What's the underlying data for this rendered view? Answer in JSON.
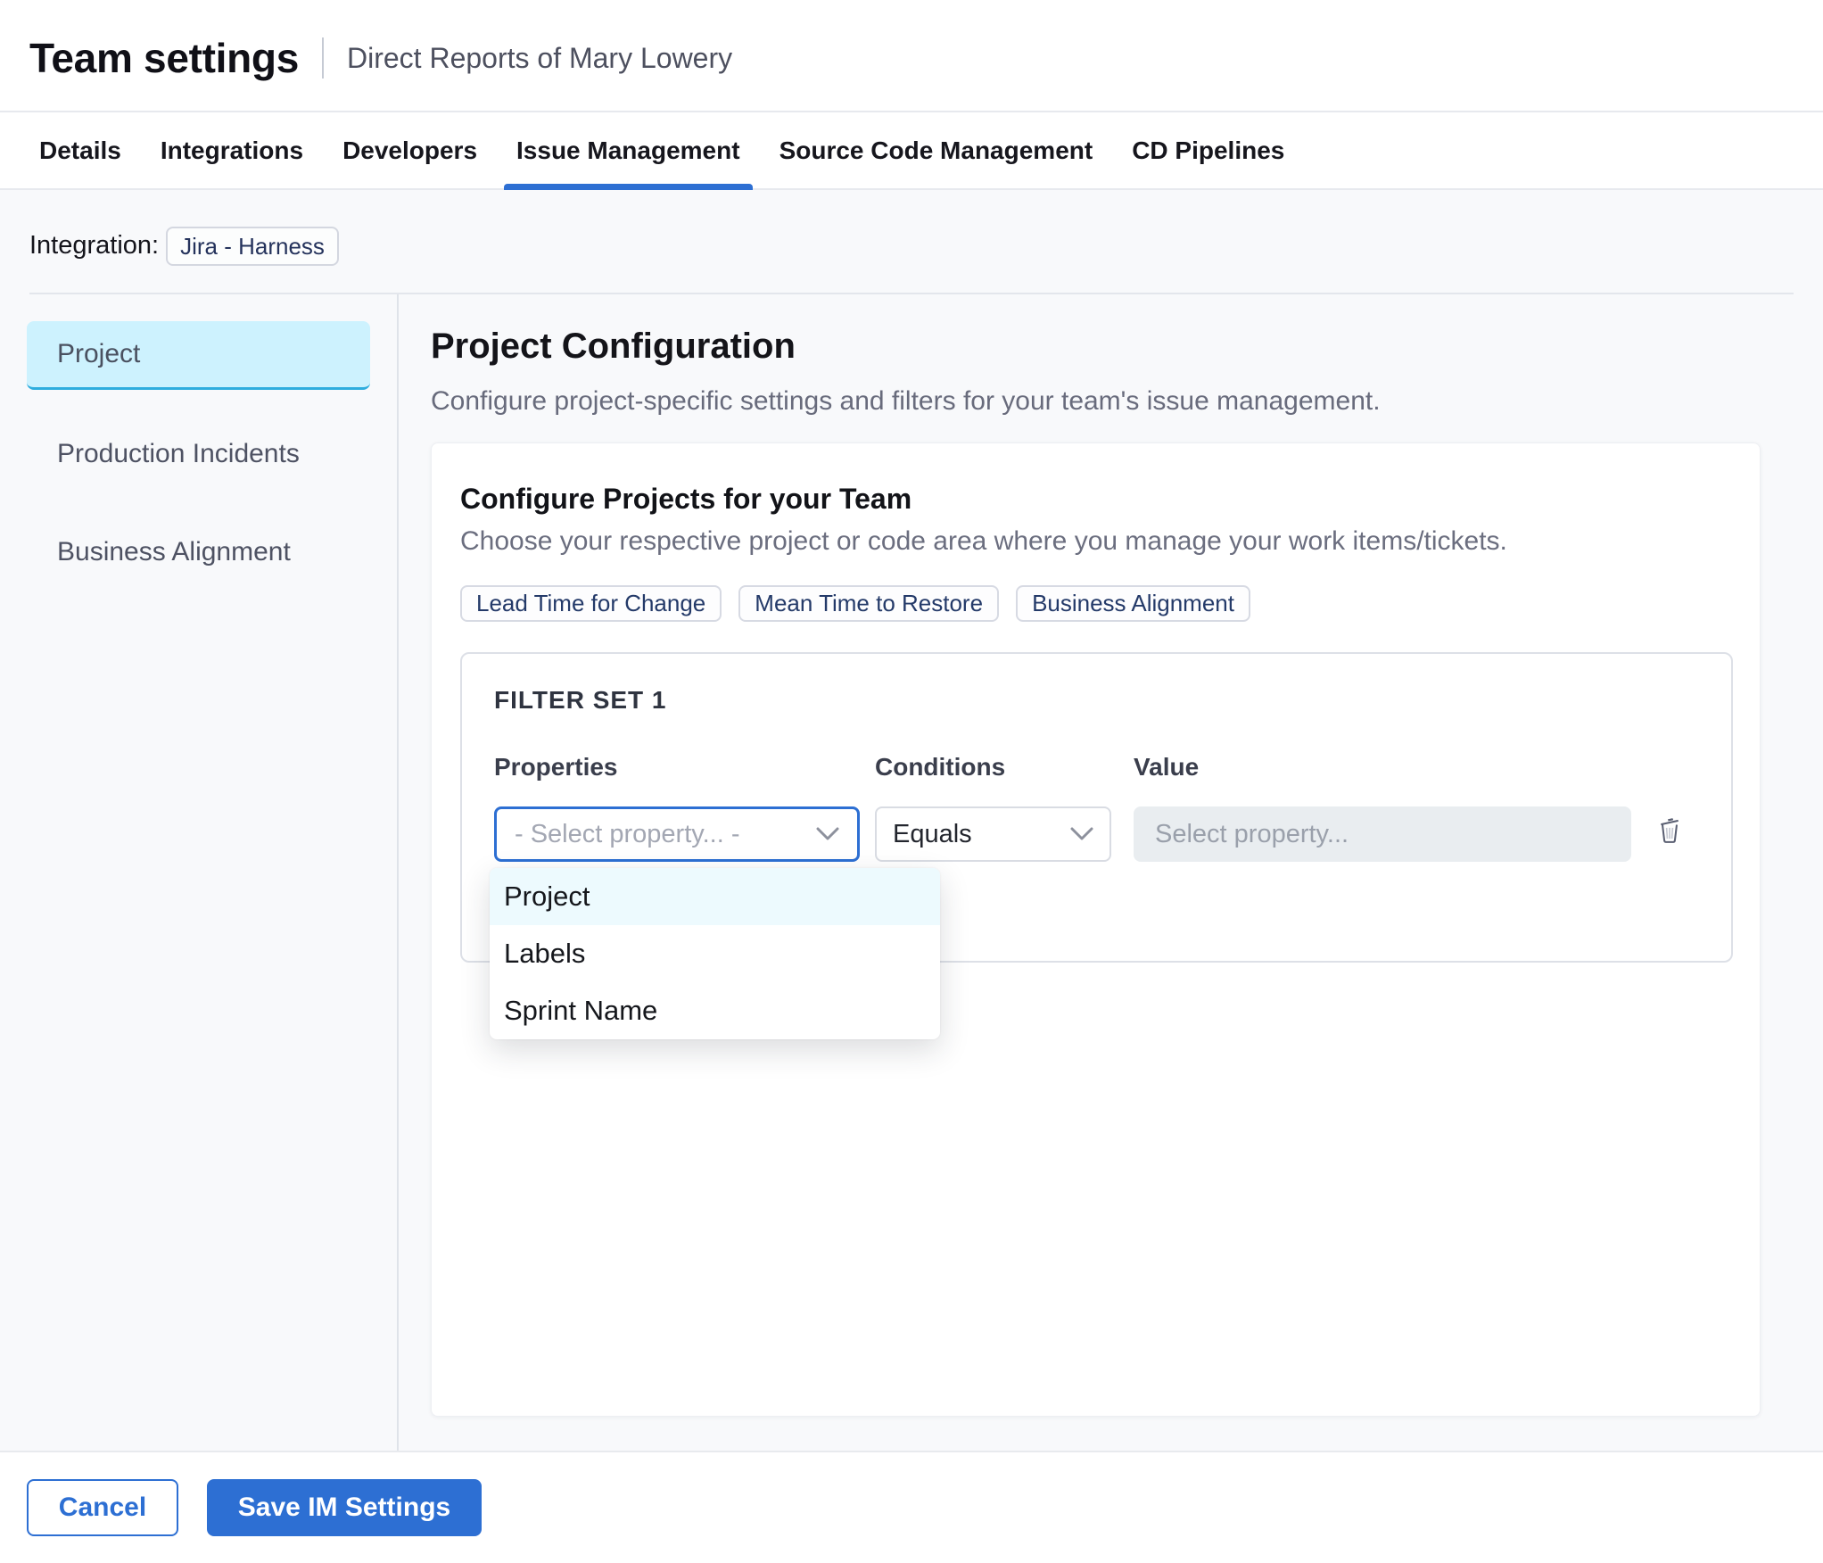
{
  "header": {
    "title": "Team settings",
    "subtitle": "Direct Reports of Mary Lowery"
  },
  "tabs": [
    {
      "label": "Details"
    },
    {
      "label": "Integrations"
    },
    {
      "label": "Developers"
    },
    {
      "label": "Issue Management"
    },
    {
      "label": "Source Code Management"
    },
    {
      "label": "CD Pipelines"
    }
  ],
  "integration": {
    "label": "Integration:",
    "chip": "Jira - Harness"
  },
  "sidebar": {
    "items": [
      {
        "label": "Project"
      },
      {
        "label": "Production Incidents"
      },
      {
        "label": "Business Alignment"
      }
    ]
  },
  "main": {
    "title": "Project Configuration",
    "description": "Configure project-specific settings and filters for your team's issue management.",
    "card": {
      "title": "Configure Projects for your Team",
      "description": "Choose your respective project or code area where you manage your work items/tickets.",
      "chips": [
        "Lead Time for Change",
        "Mean Time to Restore",
        "Business Alignment"
      ],
      "filter_set": {
        "title": "FILTER SET 1",
        "columns": {
          "properties": "Properties",
          "conditions": "Conditions",
          "value": "Value"
        },
        "property_placeholder": "- Select property... -",
        "condition_value": "Equals",
        "value_placeholder": "Select property...",
        "menu_items": [
          "Project",
          "Labels",
          "Sprint Name"
        ]
      }
    }
  },
  "footer": {
    "cancel": "Cancel",
    "save": "Save IM Settings"
  },
  "colors": {
    "primary": "#2d6fd3",
    "selected_item_bg": "#cdf2fe",
    "selected_item_border": "#16a5e0",
    "menu_highlight": "#edfafe"
  }
}
